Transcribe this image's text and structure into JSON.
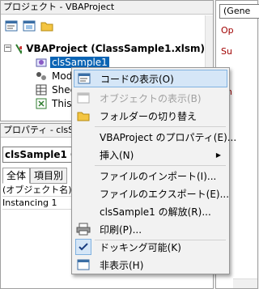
{
  "project_window": {
    "title": "プロジェクト - VBAProject",
    "toolbar": {
      "view_code": "view-code-icon",
      "view_object": "view-object-icon",
      "toggle_folders": "folder-icon"
    },
    "tree": {
      "root_label": "VBAProject (ClassSample1.xlsm)",
      "items": [
        {
          "label": "clsSample1",
          "selected": true,
          "icon": "class-module-icon"
        },
        {
          "label": "Modu",
          "icon": "module-icon"
        },
        {
          "label": "Shee",
          "icon": "sheet-icon"
        },
        {
          "label": "ThisW",
          "icon": "workbook-icon"
        }
      ]
    }
  },
  "code_window": {
    "combo_value": "(Gene",
    "lines": [
      "Op",
      "Su",
      "En"
    ]
  },
  "properties_window": {
    "title": "プロパティ - clsSam",
    "object_combo": "clsSample1  Cl",
    "tabs": [
      "全体",
      "項目別"
    ],
    "rows": [
      {
        "text": "(オブジェクト名) c"
      },
      {
        "text": "Instancing    1"
      }
    ]
  },
  "context_menu": {
    "items": [
      {
        "label": "コードの表示(O)",
        "icon": "view-code-icon",
        "highlight": true
      },
      {
        "label": "オブジェクトの表示(B)",
        "icon": "view-object-icon",
        "disabled": true
      },
      {
        "label": "フォルダーの切り替え",
        "icon": "folder-icon"
      },
      {
        "label": "VBAProject のプロパティ(E)..."
      },
      {
        "label": "挿入(N)",
        "submenu": true
      },
      {
        "label": "ファイルのインポート(I)..."
      },
      {
        "label": "ファイルのエクスポート(E)..."
      },
      {
        "label": "clsSample1 の解放(R)..."
      },
      {
        "label": "印刷(P)...",
        "icon": "printer-icon"
      },
      {
        "label": "ドッキング可能(K)",
        "icon": "checkmark-icon",
        "checked": true
      },
      {
        "label": "非表示(H)",
        "icon": "hide-window-icon"
      }
    ]
  },
  "colors": {
    "selection": "#0a64b4",
    "menu_highlight": "#d5e6f7",
    "menu_border": "#7fb1e0",
    "code_keyword": "#a00000"
  }
}
